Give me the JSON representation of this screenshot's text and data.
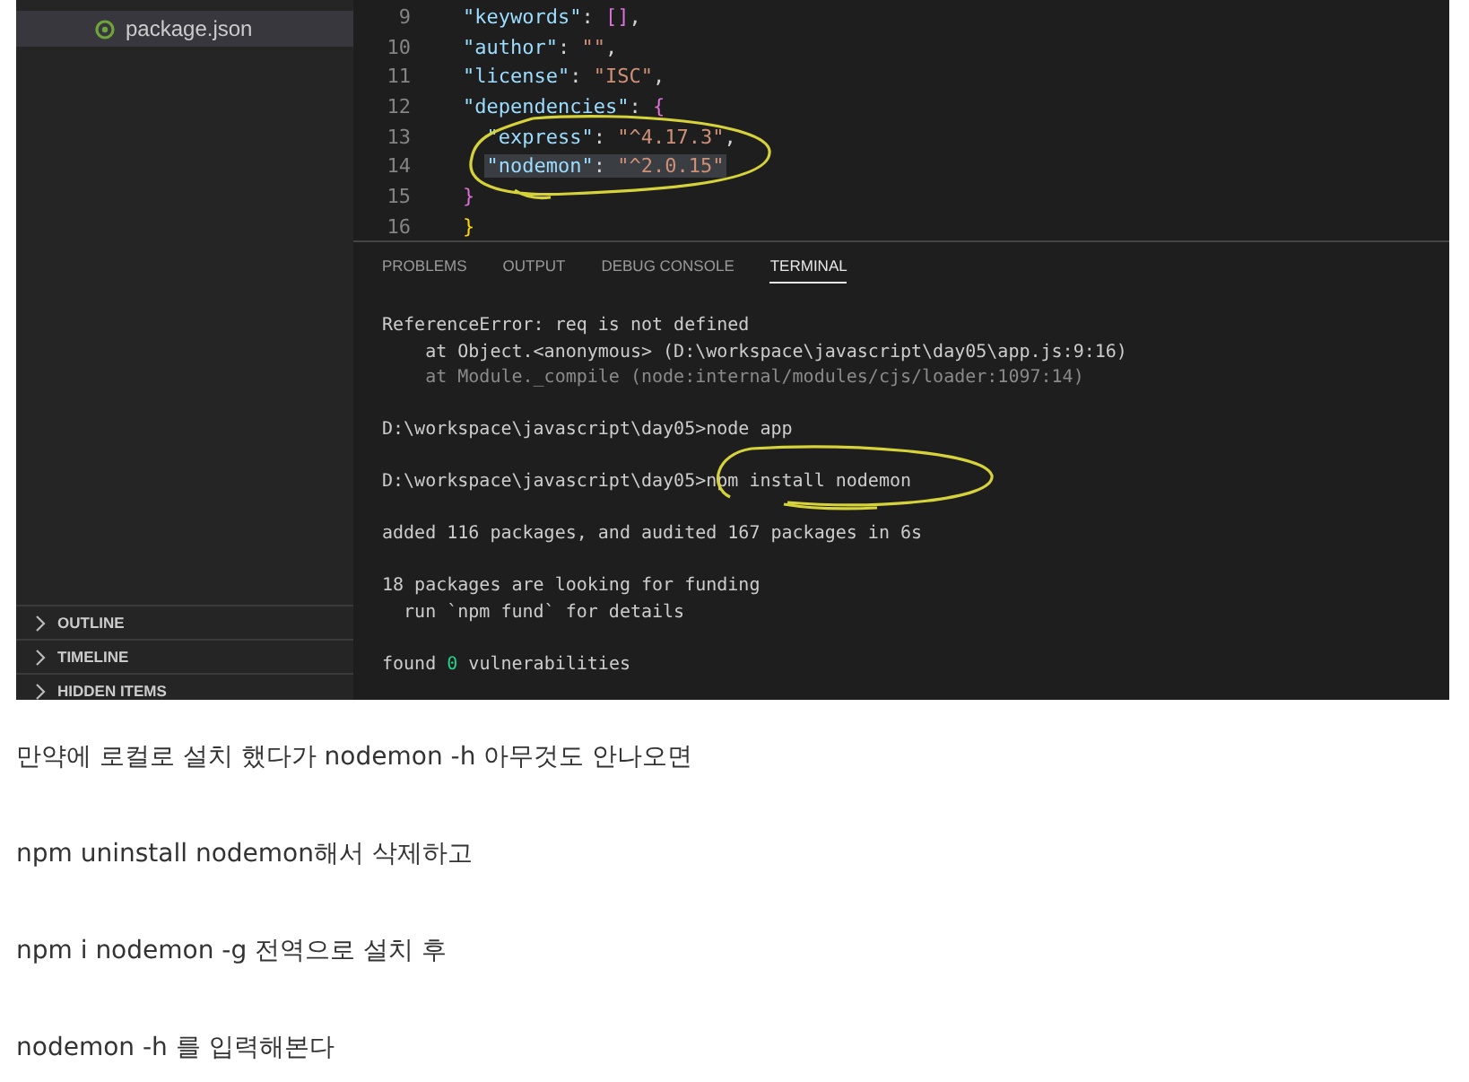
{
  "screenshot": {
    "explorer": {
      "files": [
        {
          "name": "package.json",
          "selected": true
        }
      ],
      "sections": [
        {
          "label": "OUTLINE",
          "expanded": false
        },
        {
          "label": "TIMELINE",
          "expanded": false
        },
        {
          "label": "HIDDEN ITEMS",
          "expanded": false
        }
      ]
    },
    "editor": {
      "lines": [
        {
          "number": "9",
          "selected": false,
          "tokens": [
            {
              "kind": "key",
              "text": "\"keywords\""
            },
            {
              "kind": "punct",
              "text": ": "
            },
            {
              "kind": "bracket",
              "text": "[]"
            },
            {
              "kind": "punct",
              "text": ","
            }
          ]
        },
        {
          "number": "10",
          "selected": false,
          "tokens": [
            {
              "kind": "key",
              "text": "\"author\""
            },
            {
              "kind": "punct",
              "text": ": "
            },
            {
              "kind": "string",
              "text": "\"\""
            },
            {
              "kind": "punct",
              "text": ","
            }
          ]
        },
        {
          "number": "11",
          "selected": false,
          "tokens": [
            {
              "kind": "key",
              "text": "\"license\""
            },
            {
              "kind": "punct",
              "text": ": "
            },
            {
              "kind": "string",
              "text": "\"ISC\""
            },
            {
              "kind": "punct",
              "text": ","
            }
          ]
        },
        {
          "number": "12",
          "selected": false,
          "tokens": [
            {
              "kind": "key",
              "text": "\"dependencies\""
            },
            {
              "kind": "punct",
              "text": ": "
            },
            {
              "kind": "bracket",
              "text": "{"
            }
          ]
        },
        {
          "number": "13",
          "selected": false,
          "indented": true,
          "tokens": [
            {
              "kind": "key",
              "text": "\"express\""
            },
            {
              "kind": "punct",
              "text": ": "
            },
            {
              "kind": "string",
              "text": "\"^4.17.3\""
            },
            {
              "kind": "punct",
              "text": ","
            }
          ]
        },
        {
          "number": "14",
          "selected": true,
          "indented": true,
          "tokens": [
            {
              "kind": "key",
              "text": "\"nodemon\""
            },
            {
              "kind": "punct",
              "text": ": "
            },
            {
              "kind": "string",
              "text": "\"^2.0.15\""
            }
          ]
        },
        {
          "number": "15",
          "selected": false,
          "tokens": [
            {
              "kind": "bracket",
              "text": "}"
            }
          ]
        },
        {
          "number": "16",
          "selected": false,
          "tokens": [
            {
              "kind": "brace",
              "text": "}"
            }
          ]
        }
      ]
    },
    "panel": {
      "tabs": [
        {
          "label": "PROBLEMS",
          "selected": false
        },
        {
          "label": "OUTPUT",
          "selected": false
        },
        {
          "label": "DEBUG CONSOLE",
          "selected": false
        },
        {
          "label": "TERMINAL",
          "selected": true
        }
      ],
      "terminal_blocks": [
        [
          [
            {
              "kind": "normal",
              "text": "ReferenceError: req is not defined"
            }
          ],
          [
            {
              "kind": "normal",
              "text": "    at Object.<anonymous> (D:\\workspace\\javascript\\day05\\app.js:9:16)"
            }
          ],
          [
            {
              "kind": "dim",
              "text": "    at Module._compile (node:internal/modules/cjs/loader:1097:14)"
            }
          ]
        ],
        [
          [
            {
              "kind": "normal",
              "text": "D:\\workspace\\javascript\\day05>node app"
            }
          ]
        ],
        [
          [
            {
              "kind": "normal",
              "text": "D:\\workspace\\javascript\\day05>npm install nodemon"
            }
          ]
        ],
        [
          [
            {
              "kind": "normal",
              "text": "added 116 packages, and audited 167 packages in 6s"
            }
          ]
        ],
        [
          [
            {
              "kind": "normal",
              "text": "18 packages are looking for funding"
            }
          ],
          [
            {
              "kind": "normal",
              "text": "  run `npm fund` for details"
            }
          ]
        ],
        [
          [
            {
              "kind": "normal",
              "text": "found "
            },
            {
              "kind": "green",
              "text": "0"
            },
            {
              "kind": "normal",
              "text": " vulnerabilities"
            }
          ]
        ]
      ]
    }
  },
  "paragraphs": [
    "만약에 로컬로 설치 했다가 nodemon -h 아무것도 안나오면",
    "npm uninstall nodemon해서 삭제하고",
    "npm i nodemon -g 전역으로 설치 후",
    "nodemon -h 를 입력해본다"
  ]
}
